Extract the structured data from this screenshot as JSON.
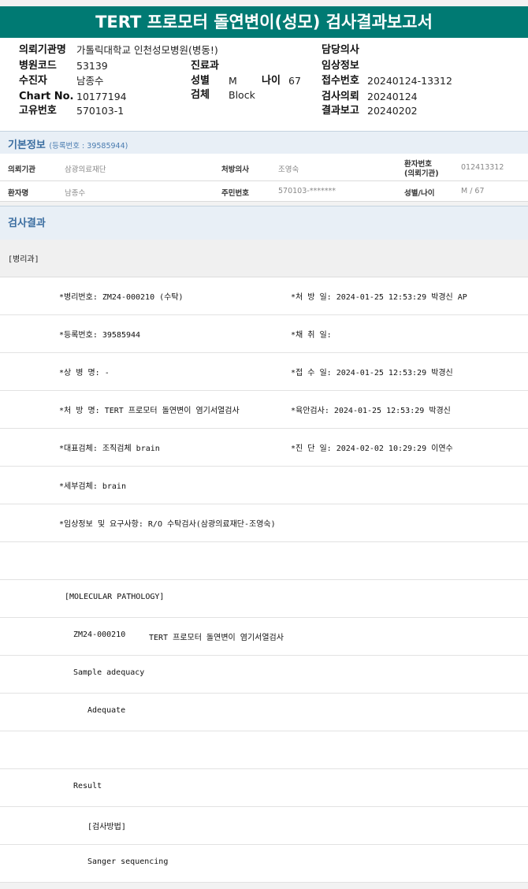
{
  "report_title": "TERT 프로모터 돌연변이(성모) 검사결과보고서",
  "header": {
    "institution_label": "의뢰기관명",
    "institution_value": "가톨릭대학교 인천성모병원(병동!)",
    "hospital_code_label": "병원코드",
    "hospital_code_value": "53139",
    "receiver_label": "수진자",
    "receiver_value": "남종수",
    "chart_no_label": "Chart No.",
    "chart_no_value": "10177194",
    "unique_no_label": "고유번호",
    "unique_no_value": "570103-1",
    "dept_label": "진료과",
    "dept_value": "",
    "sex_label": "성별",
    "sex_value": "M",
    "age_label": "나이",
    "age_value": "67",
    "specimen_label": "검체",
    "specimen_value": "Block",
    "doctor_label": "담당의사",
    "doctor_value": "",
    "clinical_label": "임상정보",
    "clinical_value": "",
    "receipt_no_label": "접수번호",
    "receipt_no_value": "20240124-13312",
    "request_label": "검사의뢰",
    "request_value": "20240124",
    "report_label": "결과보고",
    "report_value": "20240202"
  },
  "basic_info": {
    "title": "기본정보",
    "subtitle": "(등록번호 : 39585944)",
    "req_inst_label": "의뢰기관",
    "req_inst_value": "삼광의료재단",
    "prescriber_label": "처방의사",
    "prescriber_value": "조영숙",
    "patient_no_label_1": "환자번호",
    "patient_no_label_2": "(의뢰기관)",
    "patient_no_value": "012413312",
    "patient_name_label": "환자명",
    "patient_name_value": "남종수",
    "resident_no_label": "주민번호",
    "resident_no_value": "570103-*******",
    "sex_age_label": "성별/나이",
    "sex_age_value": "M / 67"
  },
  "result_section": {
    "title": "검사결과",
    "dept_tag": "[병리과]",
    "rows": [
      {
        "left": "*병리번호: ZM24-000210 (수탁)",
        "right": "*처 방 일: 2024-01-25 12:53:29  박경신 AP"
      },
      {
        "left": "*등록번호: 39585944",
        "right": "*채 취 일:"
      },
      {
        "left": "*상 병 명: -",
        "right": "*접 수 일: 2024-01-25 12:53:29  박경신"
      },
      {
        "left": "*처 방 명: TERT 프로모터 돌연변이 염기서열검사",
        "right": "*육안검사: 2024-01-25 12:53:29  박경신"
      },
      {
        "left": "*대표검체: 조직검체 brain",
        "right": "*진 단 일: 2024-02-02 10:29:29  이연수"
      },
      {
        "left": "*세부검체: brain",
        "right": ""
      },
      {
        "left": "*임상정보 및 요구사항: R/O 수탁검사(삼광의료재단-조영숙)",
        "right": ""
      }
    ],
    "mp_title": "[MOLECULAR PATHOLOGY]",
    "mp_test_id": "ZM24-000210",
    "mp_test_name": "TERT 프로모터 돌연변이 염기서열검사",
    "sample_adequacy_label": "Sample adequacy",
    "sample_adequacy_value": "Adequate",
    "result_label": "Result",
    "method_label": "[검사방법]",
    "method_value": "Sanger sequencing"
  }
}
